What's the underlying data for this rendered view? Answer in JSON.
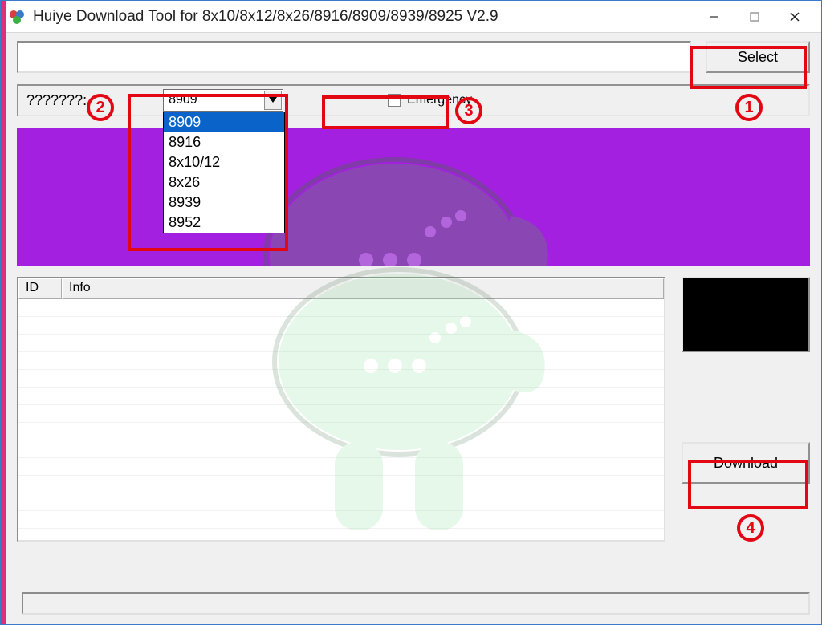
{
  "window": {
    "title": "Huiye Download Tool for 8x10/8x12/8x26/8916/8909/8939/8925 V2.9"
  },
  "toolbar": {
    "select_label": "Select"
  },
  "options": {
    "label": "???????:",
    "combo_value": "8909",
    "combo_items": [
      "8909",
      "8916",
      "8x10/12",
      "8x26",
      "8939",
      "8952"
    ],
    "emergency_label": "Emergency",
    "emergency_checked": false
  },
  "list": {
    "col_id": "ID",
    "col_info": "Info"
  },
  "actions": {
    "download_label": "Download"
  },
  "annotations": {
    "n1": "1",
    "n2": "2",
    "n3": "3",
    "n4": "4"
  }
}
